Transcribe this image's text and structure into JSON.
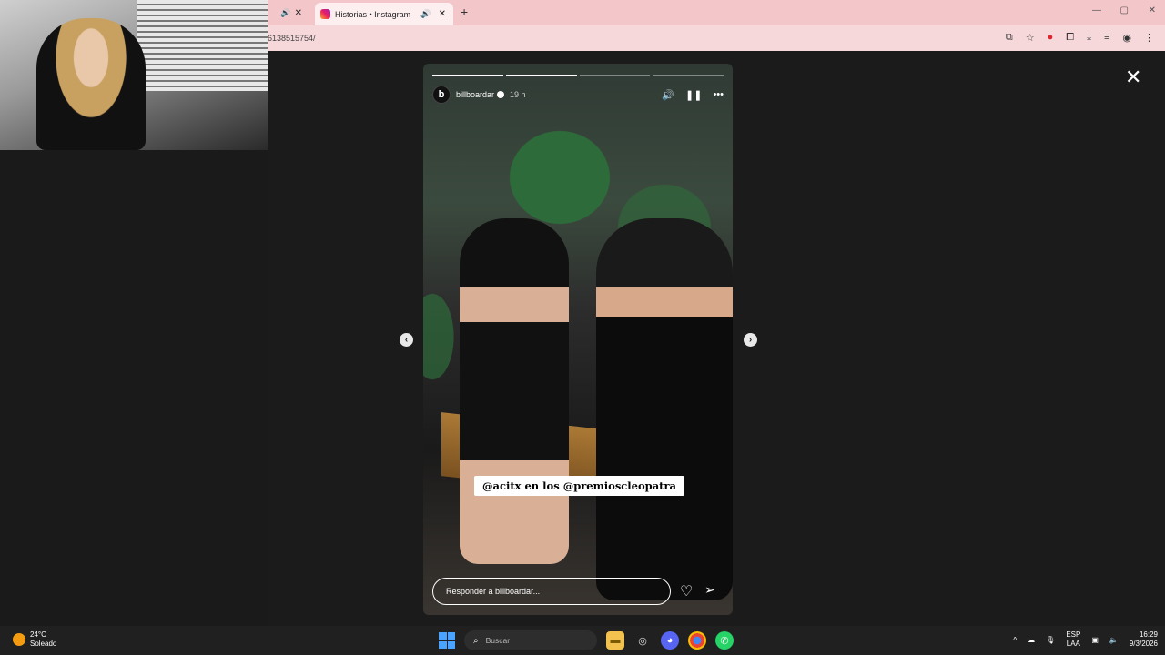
{
  "browser": {
    "tabs": [
      {
        "label": "",
        "active": false
      },
      {
        "label": "Historias • Instagram",
        "active": true
      }
    ],
    "url": "6138515754/"
  },
  "story": {
    "username": "billboardar",
    "time_ago": "19 h",
    "caption": "@acitx en los @premioscleopatra",
    "reply_placeholder": "Responder a billboardar...",
    "avatar_letter": "b",
    "progress_segments": 4,
    "progress_completed": 2
  },
  "taskbar": {
    "weather_temp": "24°C",
    "weather_desc": "Soleado",
    "search_placeholder": "Buscar",
    "lang_top": "ESP",
    "lang_bottom": "LAA",
    "clock_time": "16:29",
    "clock_date": "9/3/2026"
  }
}
